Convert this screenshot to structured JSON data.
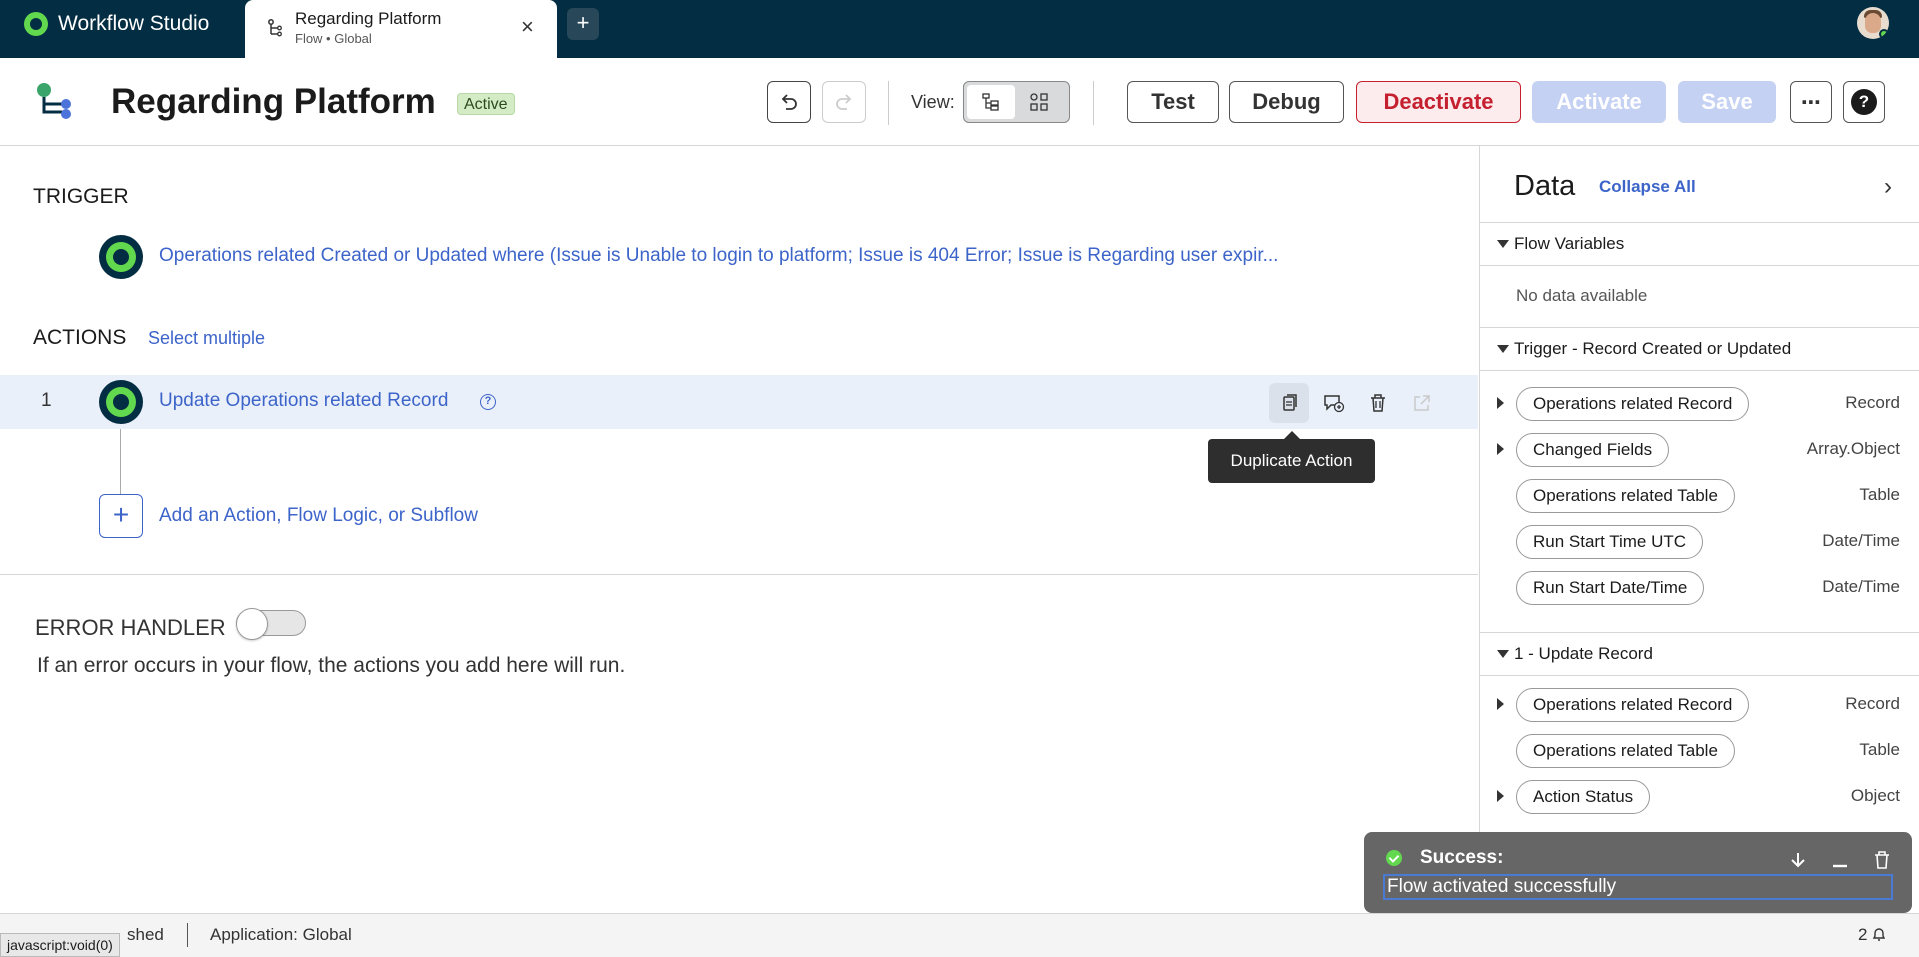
{
  "app": {
    "name": "Workflow Studio"
  },
  "tab": {
    "title": "Regarding Platform",
    "subtitle": "Flow • Global",
    "close": "×",
    "new_tab": "+"
  },
  "header": {
    "title": "Regarding Platform",
    "status": "Active",
    "view_label": "View:",
    "buttons": {
      "test": "Test",
      "debug": "Debug",
      "deactivate": "Deactivate",
      "activate": "Activate",
      "save": "Save",
      "more": "⋯",
      "help": "?"
    }
  },
  "trigger": {
    "heading": "TRIGGER",
    "text": "Operations related Created or Updated where (Issue is Unable to login to platform; Issue is 404 Error; Issue is Regarding user expir..."
  },
  "actions": {
    "heading": "ACTIONS",
    "select_multiple": "Select multiple",
    "items": [
      {
        "number": "1",
        "title": "Update Operations related Record"
      }
    ],
    "add_label": "Add an Action, Flow Logic, or Subflow",
    "add_icon": "+",
    "tooltip": "Duplicate Action"
  },
  "error_handler": {
    "heading": "ERROR HANDLER",
    "enabled": false,
    "description": "If an error occurs in your flow, the actions you add here will run."
  },
  "data_panel": {
    "title": "Data",
    "collapse_all": "Collapse All",
    "chevron": "›",
    "sections": [
      {
        "label": "Flow Variables",
        "empty_text": "No data available"
      },
      {
        "label": "Trigger - Record Created or Updated",
        "items": [
          {
            "name": "Operations related Record",
            "type": "Record",
            "expandable": true
          },
          {
            "name": "Changed Fields",
            "type": "Array.Object",
            "expandable": true
          },
          {
            "name": "Operations related Table",
            "type": "Table",
            "expandable": false
          },
          {
            "name": "Run Start Time UTC",
            "type": "Date/Time",
            "expandable": false
          },
          {
            "name": "Run Start Date/Time",
            "type": "Date/Time",
            "expandable": false
          }
        ]
      },
      {
        "label": "1 - Update Record",
        "items": [
          {
            "name": "Operations related Record",
            "type": "Record",
            "expandable": true
          },
          {
            "name": "Operations related Table",
            "type": "Table",
            "expandable": false
          },
          {
            "name": "Action Status",
            "type": "Object",
            "expandable": true
          }
        ]
      }
    ]
  },
  "toast": {
    "title": "Success:",
    "message": "Flow activated successfully"
  },
  "status_bar": {
    "published": "shed",
    "application": "Application: Global",
    "notifications": "2",
    "link_hint": "javascript:void(0)"
  },
  "colors": {
    "topbar": "#032d42",
    "accent_green": "#62d84e",
    "link_blue": "#3c64c9",
    "danger": "#c5202f"
  }
}
